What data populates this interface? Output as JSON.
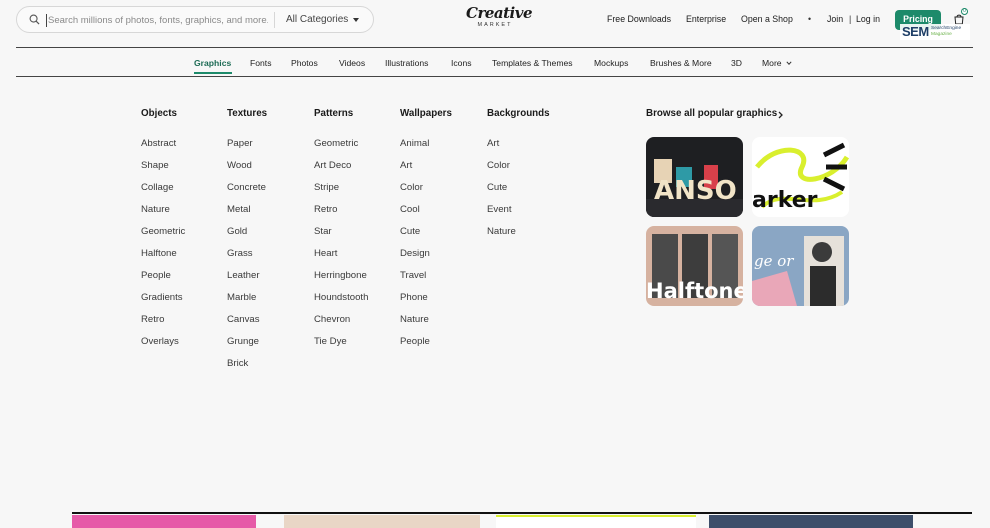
{
  "search": {
    "placeholder": "Search millions of photos, fonts, graphics, and more...",
    "category": "All Categories"
  },
  "logo": {
    "line1": "Creative",
    "line2": "MARKET"
  },
  "header_links": {
    "free_downloads": "Free Downloads",
    "enterprise": "Enterprise",
    "open_shop": "Open a Shop",
    "dot": "•",
    "join": "Join",
    "divider": "|",
    "login": "Log in",
    "pricing": "Pricing",
    "cart_count": "0"
  },
  "watermark": {
    "big": "SEM",
    "small1": "SearchEngine",
    "small2": "Magazine"
  },
  "category_nav": [
    "Graphics",
    "Fonts",
    "Photos",
    "Videos",
    "Illustrations",
    "Icons",
    "Templates & Themes",
    "Mockups",
    "Brushes & More",
    "3D",
    "More"
  ],
  "active_category": "Graphics",
  "menu": {
    "objects": {
      "title": "Objects",
      "items": [
        "Abstract",
        "Shape",
        "Collage",
        "Nature",
        "Geometric",
        "Halftone",
        "People",
        "Gradients",
        "Retro",
        "Overlays"
      ]
    },
    "textures": {
      "title": "Textures",
      "items": [
        "Paper",
        "Wood",
        "Concrete",
        "Metal",
        "Gold",
        "Grass",
        "Leather",
        "Marble",
        "Canvas",
        "Grunge",
        "Brick"
      ]
    },
    "patterns": {
      "title": "Patterns",
      "items": [
        "Geometric",
        "Art Deco",
        "Stripe",
        "Retro",
        "Star",
        "Heart",
        "Herringbone",
        "Houndstooth",
        "Chevron",
        "Tie Dye"
      ]
    },
    "wallpapers": {
      "title": "Wallpapers",
      "items": [
        "Animal",
        "Art",
        "Color",
        "Cool",
        "Cute",
        "Design",
        "Travel",
        "Phone",
        "Nature",
        "People"
      ]
    },
    "backgrounds": {
      "title": "Backgrounds",
      "items": [
        "Art",
        "Color",
        "Cute",
        "Event",
        "Nature"
      ]
    }
  },
  "browse_popular": "Browse all popular graphics",
  "thumbnails": [
    {
      "text": "ANSO"
    },
    {
      "text": "arker"
    },
    {
      "text": "Halftone"
    },
    {
      "text": "ge or"
    }
  ],
  "colors": {
    "accent": "#1d8a6a",
    "background": "#f7f7f7"
  }
}
